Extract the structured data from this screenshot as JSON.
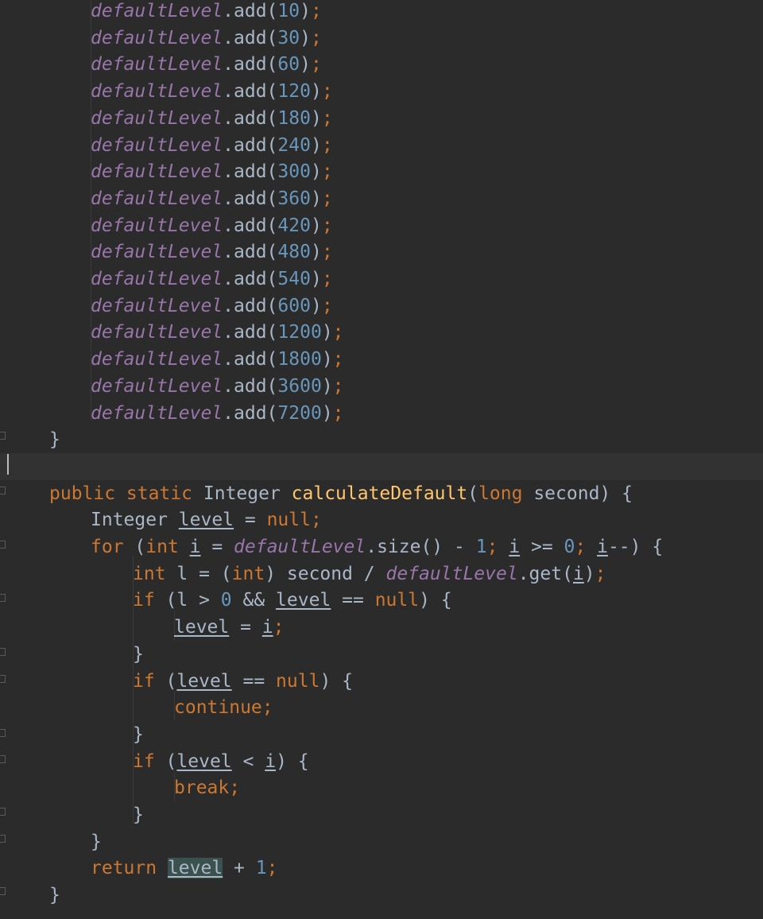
{
  "editor": {
    "language": "java",
    "colors": {
      "background": "#2b2b2b",
      "text": "#a9b7c6",
      "keyword": "#cc7832",
      "number": "#6897bb",
      "static_field": "#9876aa",
      "method_declaration": "#ffc66d",
      "identifier_highlight": "#3b514d",
      "current_line": "#323232"
    },
    "lines": [
      {
        "indent": 2,
        "tokens": [
          {
            "t": "defaultLevel",
            "k": "fld"
          },
          {
            "t": ".add(",
            "k": "p"
          },
          {
            "t": "10",
            "k": "num"
          },
          {
            "t": ")",
            "k": "p"
          },
          {
            "t": ";",
            "k": "kw"
          }
        ]
      },
      {
        "indent": 2,
        "tokens": [
          {
            "t": "defaultLevel",
            "k": "fld"
          },
          {
            "t": ".add(",
            "k": "p"
          },
          {
            "t": "30",
            "k": "num"
          },
          {
            "t": ")",
            "k": "p"
          },
          {
            "t": ";",
            "k": "kw"
          }
        ]
      },
      {
        "indent": 2,
        "tokens": [
          {
            "t": "defaultLevel",
            "k": "fld"
          },
          {
            "t": ".add(",
            "k": "p"
          },
          {
            "t": "60",
            "k": "num"
          },
          {
            "t": ")",
            "k": "p"
          },
          {
            "t": ";",
            "k": "kw"
          }
        ]
      },
      {
        "indent": 2,
        "tokens": [
          {
            "t": "defaultLevel",
            "k": "fld"
          },
          {
            "t": ".add(",
            "k": "p"
          },
          {
            "t": "120",
            "k": "num"
          },
          {
            "t": ")",
            "k": "p"
          },
          {
            "t": ";",
            "k": "kw"
          }
        ]
      },
      {
        "indent": 2,
        "tokens": [
          {
            "t": "defaultLevel",
            "k": "fld"
          },
          {
            "t": ".add(",
            "k": "p"
          },
          {
            "t": "180",
            "k": "num"
          },
          {
            "t": ")",
            "k": "p"
          },
          {
            "t": ";",
            "k": "kw"
          }
        ]
      },
      {
        "indent": 2,
        "tokens": [
          {
            "t": "defaultLevel",
            "k": "fld"
          },
          {
            "t": ".add(",
            "k": "p"
          },
          {
            "t": "240",
            "k": "num"
          },
          {
            "t": ")",
            "k": "p"
          },
          {
            "t": ";",
            "k": "kw"
          }
        ]
      },
      {
        "indent": 2,
        "tokens": [
          {
            "t": "defaultLevel",
            "k": "fld"
          },
          {
            "t": ".add(",
            "k": "p"
          },
          {
            "t": "300",
            "k": "num"
          },
          {
            "t": ")",
            "k": "p"
          },
          {
            "t": ";",
            "k": "kw"
          }
        ]
      },
      {
        "indent": 2,
        "tokens": [
          {
            "t": "defaultLevel",
            "k": "fld"
          },
          {
            "t": ".add(",
            "k": "p"
          },
          {
            "t": "360",
            "k": "num"
          },
          {
            "t": ")",
            "k": "p"
          },
          {
            "t": ";",
            "k": "kw"
          }
        ]
      },
      {
        "indent": 2,
        "tokens": [
          {
            "t": "defaultLevel",
            "k": "fld"
          },
          {
            "t": ".add(",
            "k": "p"
          },
          {
            "t": "420",
            "k": "num"
          },
          {
            "t": ")",
            "k": "p"
          },
          {
            "t": ";",
            "k": "kw"
          }
        ]
      },
      {
        "indent": 2,
        "tokens": [
          {
            "t": "defaultLevel",
            "k": "fld"
          },
          {
            "t": ".add(",
            "k": "p"
          },
          {
            "t": "480",
            "k": "num"
          },
          {
            "t": ")",
            "k": "p"
          },
          {
            "t": ";",
            "k": "kw"
          }
        ]
      },
      {
        "indent": 2,
        "tokens": [
          {
            "t": "defaultLevel",
            "k": "fld"
          },
          {
            "t": ".add(",
            "k": "p"
          },
          {
            "t": "540",
            "k": "num"
          },
          {
            "t": ")",
            "k": "p"
          },
          {
            "t": ";",
            "k": "kw"
          }
        ]
      },
      {
        "indent": 2,
        "tokens": [
          {
            "t": "defaultLevel",
            "k": "fld"
          },
          {
            "t": ".add(",
            "k": "p"
          },
          {
            "t": "600",
            "k": "num"
          },
          {
            "t": ")",
            "k": "p"
          },
          {
            "t": ";",
            "k": "kw"
          }
        ]
      },
      {
        "indent": 2,
        "tokens": [
          {
            "t": "defaultLevel",
            "k": "fld"
          },
          {
            "t": ".add(",
            "k": "p"
          },
          {
            "t": "1200",
            "k": "num"
          },
          {
            "t": ")",
            "k": "p"
          },
          {
            "t": ";",
            "k": "kw"
          }
        ]
      },
      {
        "indent": 2,
        "tokens": [
          {
            "t": "defaultLevel",
            "k": "fld"
          },
          {
            "t": ".add(",
            "k": "p"
          },
          {
            "t": "1800",
            "k": "num"
          },
          {
            "t": ")",
            "k": "p"
          },
          {
            "t": ";",
            "k": "kw"
          }
        ]
      },
      {
        "indent": 2,
        "tokens": [
          {
            "t": "defaultLevel",
            "k": "fld"
          },
          {
            "t": ".add(",
            "k": "p"
          },
          {
            "t": "3600",
            "k": "num"
          },
          {
            "t": ")",
            "k": "p"
          },
          {
            "t": ";",
            "k": "kw"
          }
        ]
      },
      {
        "indent": 2,
        "tokens": [
          {
            "t": "defaultLevel",
            "k": "fld"
          },
          {
            "t": ".add(",
            "k": "p"
          },
          {
            "t": "7200",
            "k": "num"
          },
          {
            "t": ")",
            "k": "p"
          },
          {
            "t": ";",
            "k": "kw"
          }
        ]
      },
      {
        "indent": 1,
        "tokens": [
          {
            "t": "}",
            "k": "p"
          }
        ]
      },
      {
        "indent": 1,
        "current": true,
        "tokens": []
      },
      {
        "indent": 1,
        "tokens": [
          {
            "t": "public static ",
            "k": "kw"
          },
          {
            "t": "Integer ",
            "k": "p"
          },
          {
            "t": "calculateDefault",
            "k": "fn"
          },
          {
            "t": "(",
            "k": "p"
          },
          {
            "t": "long ",
            "k": "kw"
          },
          {
            "t": "second) {",
            "k": "p"
          }
        ]
      },
      {
        "indent": 2,
        "tokens": [
          {
            "t": "Integer ",
            "k": "p"
          },
          {
            "t": "level",
            "k": "var"
          },
          {
            "t": " = ",
            "k": "p"
          },
          {
            "t": "null",
            "k": "kw"
          },
          {
            "t": ";",
            "k": "kw"
          }
        ]
      },
      {
        "indent": 2,
        "tokens": [
          {
            "t": "for ",
            "k": "kw"
          },
          {
            "t": "(",
            "k": "p"
          },
          {
            "t": "int ",
            "k": "kw"
          },
          {
            "t": "i",
            "k": "var"
          },
          {
            "t": " = ",
            "k": "p"
          },
          {
            "t": "defaultLevel",
            "k": "fld"
          },
          {
            "t": ".size() - ",
            "k": "p"
          },
          {
            "t": "1",
            "k": "num"
          },
          {
            "t": "; ",
            "k": "kw"
          },
          {
            "t": "i",
            "k": "var"
          },
          {
            "t": " >= ",
            "k": "p"
          },
          {
            "t": "0",
            "k": "num"
          },
          {
            "t": "; ",
            "k": "kw"
          },
          {
            "t": "i",
            "k": "var"
          },
          {
            "t": "--) {",
            "k": "p"
          }
        ]
      },
      {
        "indent": 3,
        "tokens": [
          {
            "t": "int ",
            "k": "kw"
          },
          {
            "t": "l = (",
            "k": "p"
          },
          {
            "t": "int",
            "k": "kw"
          },
          {
            "t": ") second / ",
            "k": "p"
          },
          {
            "t": "defaultLevel",
            "k": "fld"
          },
          {
            "t": ".get(",
            "k": "p"
          },
          {
            "t": "i",
            "k": "var"
          },
          {
            "t": ")",
            "k": "p"
          },
          {
            "t": ";",
            "k": "kw"
          }
        ]
      },
      {
        "indent": 3,
        "tokens": [
          {
            "t": "if ",
            "k": "kw"
          },
          {
            "t": "(l > ",
            "k": "p"
          },
          {
            "t": "0",
            "k": "num"
          },
          {
            "t": " && ",
            "k": "p"
          },
          {
            "t": "level",
            "k": "var"
          },
          {
            "t": " == ",
            "k": "p"
          },
          {
            "t": "null",
            "k": "kw"
          },
          {
            "t": ") {",
            "k": "p"
          }
        ]
      },
      {
        "indent": 4,
        "tokens": [
          {
            "t": "level",
            "k": "var"
          },
          {
            "t": " = ",
            "k": "p"
          },
          {
            "t": "i",
            "k": "var"
          },
          {
            "t": ";",
            "k": "kw"
          }
        ]
      },
      {
        "indent": 3,
        "tokens": [
          {
            "t": "}",
            "k": "p"
          }
        ]
      },
      {
        "indent": 3,
        "tokens": [
          {
            "t": "if ",
            "k": "kw"
          },
          {
            "t": "(",
            "k": "p"
          },
          {
            "t": "level",
            "k": "var"
          },
          {
            "t": " == ",
            "k": "p"
          },
          {
            "t": "null",
            "k": "kw"
          },
          {
            "t": ") {",
            "k": "p"
          }
        ]
      },
      {
        "indent": 4,
        "tokens": [
          {
            "t": "continue;",
            "k": "kw"
          }
        ]
      },
      {
        "indent": 3,
        "tokens": [
          {
            "t": "}",
            "k": "p"
          }
        ]
      },
      {
        "indent": 3,
        "tokens": [
          {
            "t": "if ",
            "k": "kw"
          },
          {
            "t": "(",
            "k": "p"
          },
          {
            "t": "level",
            "k": "var"
          },
          {
            "t": " < ",
            "k": "p"
          },
          {
            "t": "i",
            "k": "var"
          },
          {
            "t": ") {",
            "k": "p"
          }
        ]
      },
      {
        "indent": 4,
        "tokens": [
          {
            "t": "break;",
            "k": "kw"
          }
        ]
      },
      {
        "indent": 3,
        "tokens": [
          {
            "t": "}",
            "k": "p"
          }
        ]
      },
      {
        "indent": 2,
        "tokens": [
          {
            "t": "}",
            "k": "p"
          }
        ]
      },
      {
        "indent": 2,
        "tokens": [
          {
            "t": "return ",
            "k": "kw"
          },
          {
            "t": "level",
            "k": "var hl"
          },
          {
            "t": " + ",
            "k": "p"
          },
          {
            "t": "1",
            "k": "num"
          },
          {
            "t": ";",
            "k": "kw"
          }
        ]
      },
      {
        "indent": 1,
        "tokens": [
          {
            "t": "}",
            "k": "p"
          }
        ]
      }
    ]
  }
}
